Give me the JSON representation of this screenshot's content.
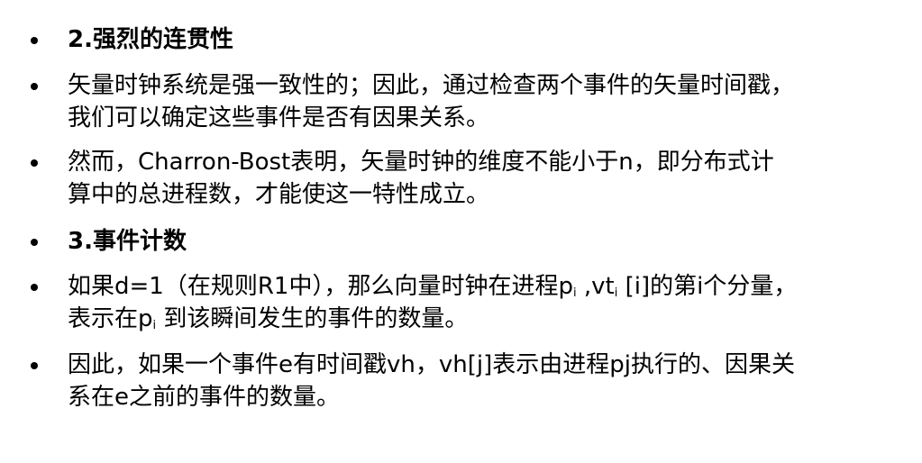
{
  "bullets": [
    {
      "heading": "2.强烈的连贯性"
    },
    {
      "line1": "矢量时钟系统是强一致性的；因此，通过检查两个事件的矢量时间戳，",
      "line2": "我们可以确定这些事件是否有因果关系。"
    },
    {
      "line1": "然而，Charron-Bost表明，矢量时钟的维度不能小于n，即分布式计",
      "line2": "算中的总进程数，才能使这一特性成立。"
    },
    {
      "heading": "3.事件计数"
    },
    {
      "line1_a": "如果d=1（在规则R1中），那么向量时钟在进程p",
      "line1_sub1": "i",
      "line1_b": " ,vt",
      "line1_sub2": "i",
      "line1_c": " [i]的第i个分量，",
      "line2_a": "表示在p",
      "line2_sub": "i",
      "line2_b": " 到该瞬间发生的事件的数量。"
    },
    {
      "line1": "因此，如果一个事件e有时间戳vh，vh[j]表示由进程pj执行的、因果关",
      "line2": "系在e之前的事件的数量。"
    }
  ]
}
